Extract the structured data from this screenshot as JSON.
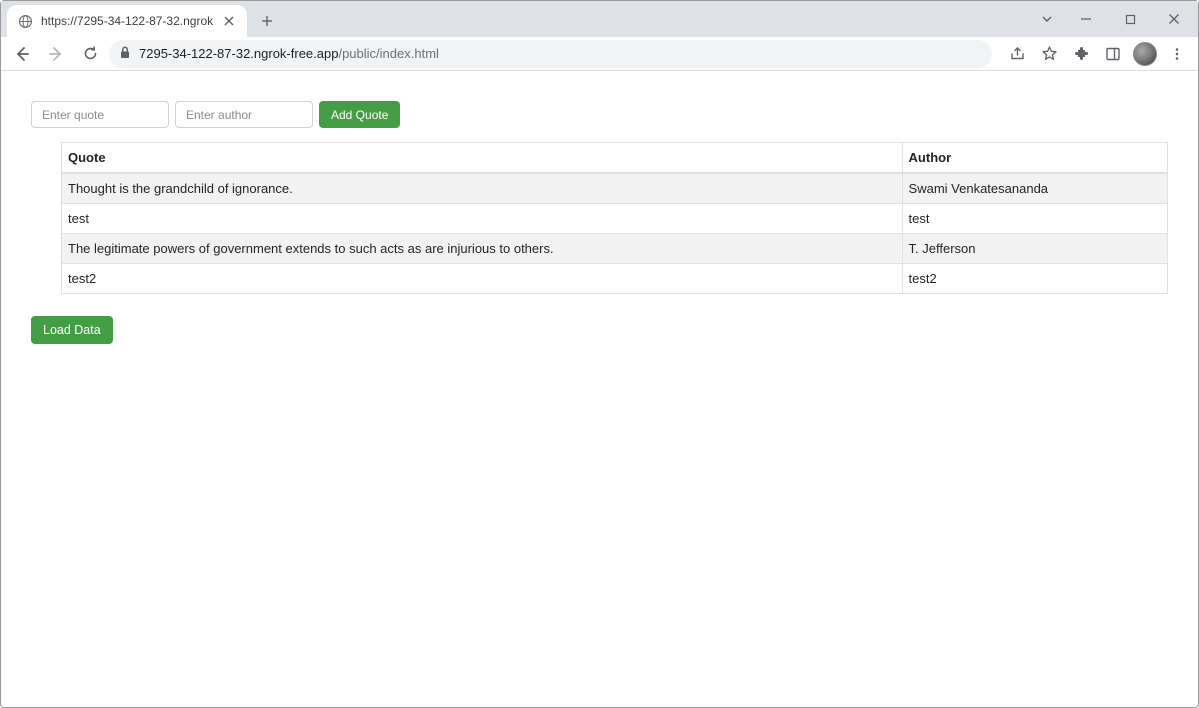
{
  "browser": {
    "tab_title": "https://7295-34-122-87-32.ngrok",
    "url_host": "7295-34-122-87-32.ngrok-free.app",
    "url_path": "/public/index.html"
  },
  "form": {
    "quote_placeholder": "Enter quote",
    "author_placeholder": "Enter author",
    "add_label": "Add Quote",
    "load_label": "Load Data"
  },
  "table": {
    "headers": {
      "quote": "Quote",
      "author": "Author"
    },
    "rows": [
      {
        "quote": "Thought is the grandchild of ignorance.",
        "author": "Swami Venkatesananda"
      },
      {
        "quote": "test",
        "author": "test"
      },
      {
        "quote": "The legitimate powers of government extends to such acts as are injurious to others.",
        "author": "T. Jefferson"
      },
      {
        "quote": "test2",
        "author": "test2"
      }
    ]
  }
}
